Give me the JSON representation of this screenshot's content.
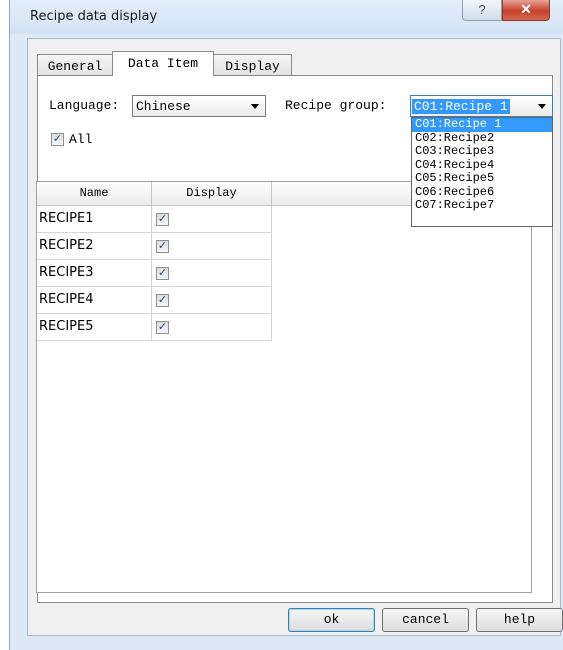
{
  "window": {
    "title": "Recipe data display",
    "help_glyph": "?",
    "close_glyph": "✕"
  },
  "tabs": [
    {
      "label": "General",
      "active": false
    },
    {
      "label": "Data Item",
      "active": true
    },
    {
      "label": "Display",
      "active": false
    }
  ],
  "language": {
    "label": "Language:",
    "value": "Chinese"
  },
  "recipe_group": {
    "label": "Recipe group:",
    "value": "C01:Recipe 1",
    "options": [
      "C01:Recipe 1",
      "C02:Recipe2",
      "C03:Recipe3",
      "C04:Recipe4",
      "C05:Recipe5",
      "C06:Recipe6",
      "C07:Recipe7"
    ]
  },
  "all_checkbox": {
    "label": "All",
    "checked": true,
    "glyph": "✓"
  },
  "grid": {
    "columns": [
      "Name",
      "Display"
    ],
    "rows": [
      {
        "name": "RECIPE1",
        "display": true
      },
      {
        "name": "RECIPE2",
        "display": true
      },
      {
        "name": "RECIPE3",
        "display": true
      },
      {
        "name": "RECIPE4",
        "display": true
      },
      {
        "name": "RECIPE5",
        "display": true
      }
    ]
  },
  "buttons": {
    "ok": "ok",
    "cancel": "cancel",
    "help": "help"
  }
}
